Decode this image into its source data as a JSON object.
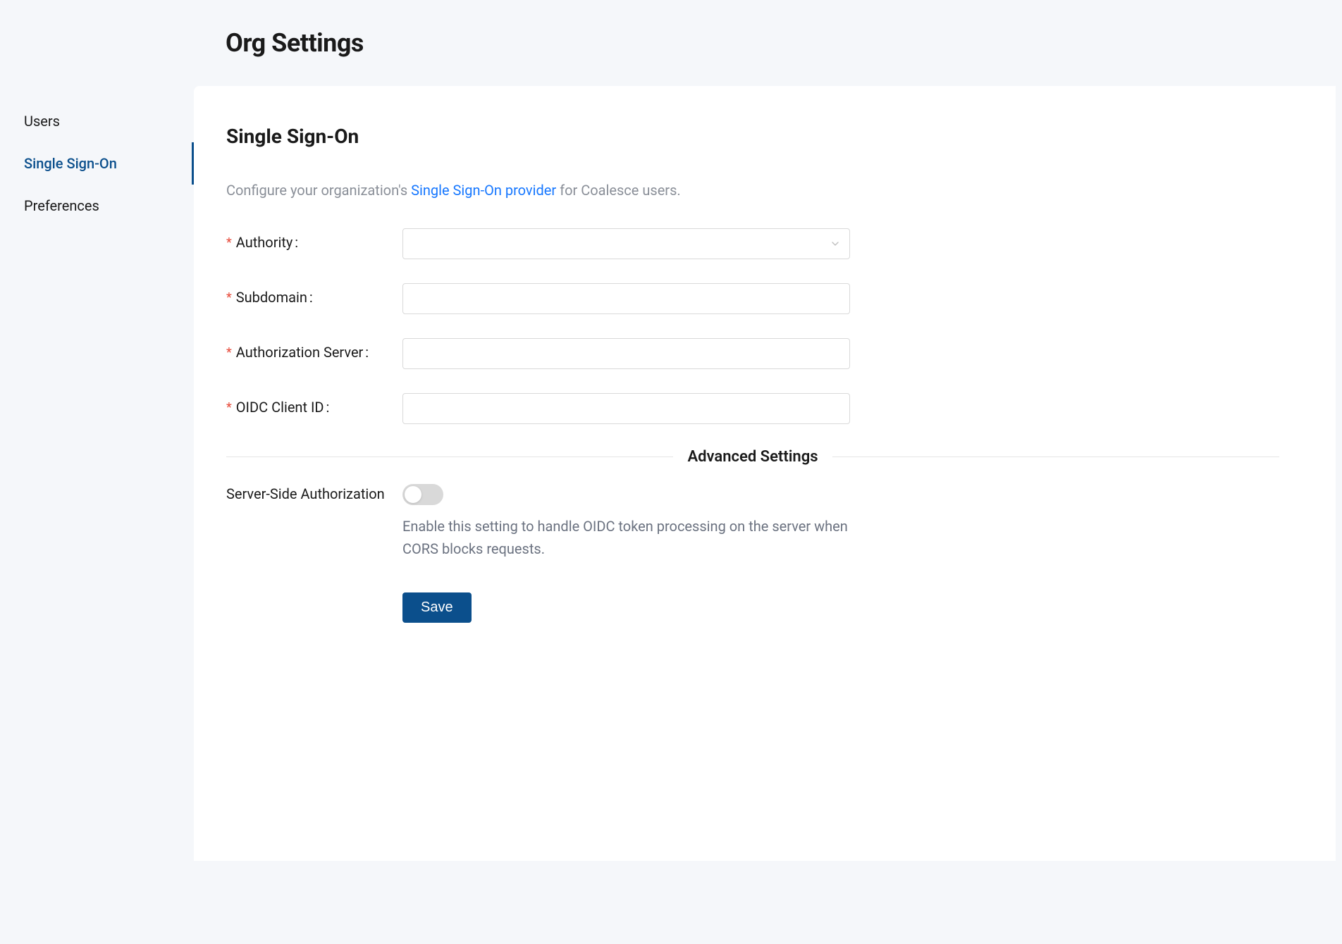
{
  "header": {
    "title": "Org Settings"
  },
  "sidebar": {
    "items": [
      {
        "label": "Users",
        "active": false
      },
      {
        "label": "Single Sign-On",
        "active": true
      },
      {
        "label": "Preferences",
        "active": false
      }
    ]
  },
  "main": {
    "heading": "Single Sign-On",
    "description": {
      "prefix": "Configure your organization's ",
      "link_text": "Single Sign-On provider",
      "suffix": " for Coalesce users."
    },
    "fields": {
      "authority": {
        "label": "Authority",
        "value": ""
      },
      "subdomain": {
        "label": "Subdomain",
        "value": ""
      },
      "auth_server": {
        "label": "Authorization Server",
        "value": ""
      },
      "oidc_client_id": {
        "label": "OIDC Client ID",
        "value": ""
      }
    },
    "advanced": {
      "divider_label": "Advanced Settings",
      "server_side_auth": {
        "label": "Server-Side Authorization",
        "enabled": false,
        "help": "Enable this setting to handle OIDC token processing on the server when CORS blocks requests."
      }
    },
    "save_label": "Save"
  }
}
